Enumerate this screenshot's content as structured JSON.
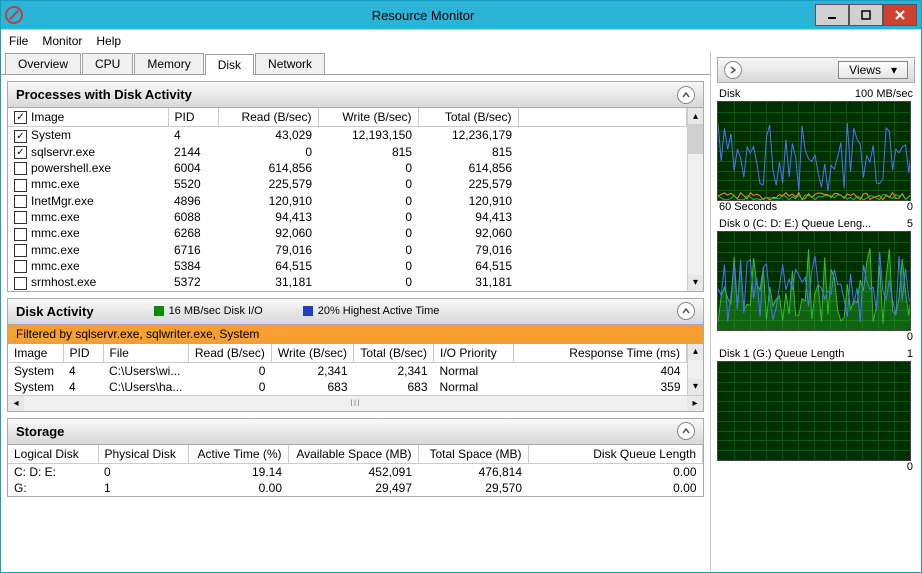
{
  "window_title": "Resource Monitor",
  "menu": [
    "File",
    "Monitor",
    "Help"
  ],
  "tabs": [
    "Overview",
    "CPU",
    "Memory",
    "Disk",
    "Network"
  ],
  "active_tab": "Disk",
  "side": {
    "views_label": "Views",
    "graphs": [
      {
        "title": "Disk",
        "right": "100 MB/sec",
        "footer_left": "60 Seconds",
        "footer_right": "0"
      },
      {
        "title": "Disk 0 (C: D: E:) Queue Leng...",
        "right": "5",
        "footer_left": "",
        "footer_right": "0"
      },
      {
        "title": "Disk 1 (G:) Queue Length",
        "right": "1",
        "footer_left": "",
        "footer_right": "0"
      }
    ]
  },
  "processes_panel": {
    "title": "Processes with Disk Activity",
    "columns": [
      "Image",
      "PID",
      "Read (B/sec)",
      "Write (B/sec)",
      "Total (B/sec)"
    ],
    "rows": [
      {
        "checked": true,
        "image": "System",
        "pid": "4",
        "read": "43,029",
        "write": "12,193,150",
        "total": "12,236,179"
      },
      {
        "checked": true,
        "image": "sqlservr.exe",
        "pid": "2144",
        "read": "0",
        "write": "815",
        "total": "815"
      },
      {
        "checked": false,
        "image": "powershell.exe",
        "pid": "6004",
        "read": "614,856",
        "write": "0",
        "total": "614,856"
      },
      {
        "checked": false,
        "image": "mmc.exe",
        "pid": "5520",
        "read": "225,579",
        "write": "0",
        "total": "225,579"
      },
      {
        "checked": false,
        "image": "InetMgr.exe",
        "pid": "4896",
        "read": "120,910",
        "write": "0",
        "total": "120,910"
      },
      {
        "checked": false,
        "image": "mmc.exe",
        "pid": "6088",
        "read": "94,413",
        "write": "0",
        "total": "94,413"
      },
      {
        "checked": false,
        "image": "mmc.exe",
        "pid": "6268",
        "read": "92,060",
        "write": "0",
        "total": "92,060"
      },
      {
        "checked": false,
        "image": "mmc.exe",
        "pid": "6716",
        "read": "79,016",
        "write": "0",
        "total": "79,016"
      },
      {
        "checked": false,
        "image": "mmc.exe",
        "pid": "5384",
        "read": "64,515",
        "write": "0",
        "total": "64,515"
      },
      {
        "checked": false,
        "image": "srmhost.exe",
        "pid": "5372",
        "read": "31,181",
        "write": "0",
        "total": "31,181"
      }
    ]
  },
  "disk_activity_panel": {
    "title": "Disk Activity",
    "legend1": "16 MB/sec Disk I/O",
    "legend2": "20% Highest Active Time",
    "filter_text": "Filtered by sqlservr.exe, sqlwriter.exe, System",
    "columns": [
      "Image",
      "PID",
      "File",
      "Read (B/sec)",
      "Write (B/sec)",
      "Total (B/sec)",
      "I/O Priority",
      "Response Time (ms)"
    ],
    "rows": [
      {
        "image": "System",
        "pid": "4",
        "file": "C:\\Users\\wi...",
        "read": "0",
        "write": "2,341",
        "total": "2,341",
        "priority": "Normal",
        "rt": "404"
      },
      {
        "image": "System",
        "pid": "4",
        "file": "C:\\Users\\ha...",
        "read": "0",
        "write": "683",
        "total": "683",
        "priority": "Normal",
        "rt": "359"
      }
    ]
  },
  "storage_panel": {
    "title": "Storage",
    "columns": [
      "Logical Disk",
      "Physical Disk",
      "Active Time (%)",
      "Available Space (MB)",
      "Total Space (MB)",
      "Disk Queue Length"
    ],
    "rows": [
      {
        "logical": "C: D: E:",
        "physical": "0",
        "active": "19.14",
        "avail": "452,091",
        "total": "476,814",
        "queue": "0.00"
      },
      {
        "logical": "G:",
        "physical": "1",
        "active": "0.00",
        "avail": "29,497",
        "total": "29,570",
        "queue": "0.00"
      }
    ]
  },
  "chart_data": [
    {
      "type": "line",
      "title": "Disk",
      "ylabel": "MB/sec",
      "ylim": [
        0,
        100
      ],
      "xlim_seconds": [
        60,
        0
      ],
      "series": [
        {
          "name": "Disk I/O",
          "color": "#4060ff"
        },
        {
          "name": "Highest Active Time",
          "color": "#40c040"
        }
      ],
      "note": "qualitative spiky trace; exact values not labeled"
    },
    {
      "type": "line",
      "title": "Disk 0 (C: D: E:) Queue Length",
      "ylim": [
        0,
        5
      ],
      "xlim_seconds": [
        60,
        0
      ],
      "series": [
        {
          "name": "Queue Length",
          "color": "#4060ff"
        }
      ],
      "note": "dense spikes reaching ~5 early, tapering"
    },
    {
      "type": "line",
      "title": "Disk 1 (G:) Queue Length",
      "ylim": [
        0,
        1
      ],
      "xlim_seconds": [
        60,
        0
      ],
      "series": [
        {
          "name": "Queue Length",
          "color": "#4060ff"
        }
      ],
      "note": "flat near zero"
    }
  ]
}
